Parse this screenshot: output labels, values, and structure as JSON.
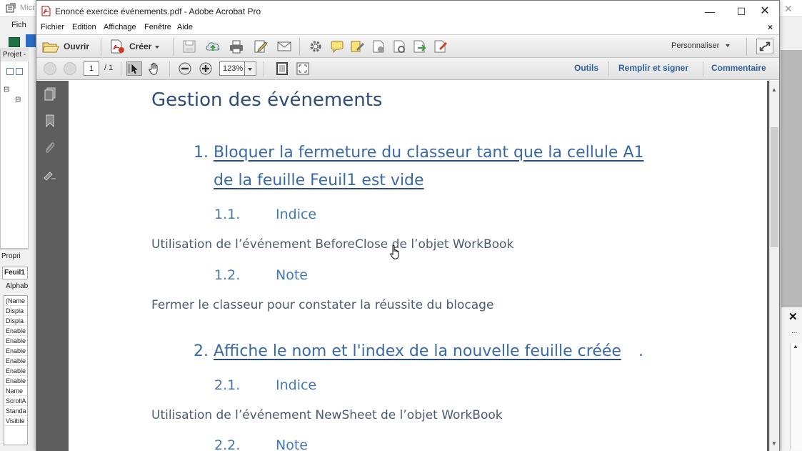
{
  "vbe": {
    "title_fragment": "Micr",
    "menu_fragment": "Fich",
    "project_header": "Projet -",
    "tree_items": [
      "⊟",
      "⊟"
    ],
    "props_header": "Propri",
    "props_object": "Feuil1",
    "props_tab": "Alphab",
    "props_rows": [
      "(Name",
      "Displa",
      "Displa",
      "Enable",
      "Enable",
      "Enable",
      "Enable",
      "Enable",
      "Enable",
      "Name",
      "ScrollA",
      "Standa",
      "Visible"
    ],
    "right_close": "✕",
    "right_dots": "..."
  },
  "window": {
    "title": "Enoncé exercice événements.pdf - Adobe Acrobat Pro",
    "minimize": "—",
    "maximize": "☐",
    "close": "✕"
  },
  "menubar": {
    "items": [
      "Fichier",
      "Edition",
      "Affichage",
      "Fenêtre",
      "Aide"
    ],
    "close": "×"
  },
  "toolbar": {
    "open_label": "Ouvrir",
    "create_label": "Créer",
    "customize_label": "Personnaliser"
  },
  "navbar": {
    "page_current": "1",
    "page_total": "/ 1",
    "zoom": "123%",
    "tools_label": "Outils",
    "fill_sign_label": "Remplir et signer",
    "comment_label": "Commentaire"
  },
  "document": {
    "heading": "Gestion des événements",
    "sections": [
      {
        "number": "1.",
        "title_lines": [
          "Bloquer la fermeture du classeur tant que la cellule A1",
          "de la feuille Feuil1 est vide"
        ],
        "subs": [
          {
            "number": "1.1.",
            "title": "Indice",
            "text": "Utilisation de l’événement BeforeClose de l’objet WorkBook"
          },
          {
            "number": "1.2.",
            "title": "Note",
            "text": "Fermer le classeur pour constater la réussite du blocage"
          }
        ]
      },
      {
        "number": "2.",
        "title_lines": [
          "Affiche le nom et l'index de la nouvelle feuille créée"
        ],
        "trailing": ".",
        "subs": [
          {
            "number": "2.1.",
            "title": "Indice",
            "text": "Utilisation de l’événement NewSheet de l’objet WorkBook"
          },
          {
            "number": "2.2.",
            "title": "Note",
            "text": ""
          }
        ]
      }
    ]
  },
  "colors": {
    "heading": "#2e4c7a",
    "section": "#3869a8",
    "link": "#2f5f9a",
    "nav_panel": "#5e5e5e"
  },
  "icons": [
    "acrobat-pdf-icon",
    "open-folder-icon",
    "create-pdf-icon",
    "save-icon",
    "upload-cloud-icon",
    "print-icon",
    "edit-icon",
    "email-icon",
    "gear-icon",
    "comment-icon",
    "highlight-icon",
    "stamp-icon",
    "protect-icon",
    "export-icon",
    "sign-icon",
    "expand-icon",
    "prev-page-icon",
    "next-page-icon",
    "select-tool-icon",
    "hand-tool-icon",
    "zoom-out-icon",
    "zoom-in-icon",
    "fit-page-icon",
    "full-screen-icon",
    "pages-panel-icon",
    "bookmarks-icon",
    "attachments-icon",
    "signatures-icon",
    "cursor-hand-icon"
  ]
}
